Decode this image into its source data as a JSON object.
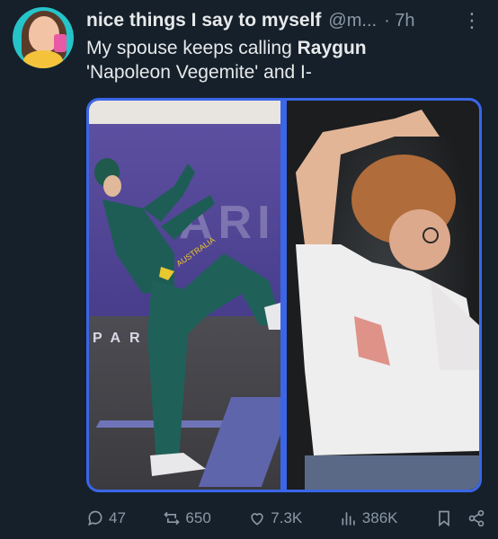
{
  "tweet": {
    "display_name": "nice things I say to myself",
    "handle": "@m...",
    "time": "· 7h",
    "more_icon": "more-icon",
    "text_part1": "My spouse keeps calling ",
    "text_bold": "Raygun",
    "text_part2": "'Napoleon Vegemite' and I-"
  },
  "media": {
    "left_banner_text": "ARI",
    "left_floor_text": "PAR   S",
    "left_jersey_text": "AUSTRALIA"
  },
  "actions": {
    "replies": "47",
    "reposts": "650",
    "likes": "7.3K",
    "views": "386K"
  },
  "colors": {
    "background": "#15202b",
    "accent": "#3b66e8",
    "muted_text": "#8b98a5",
    "primary_text": "#e7e9ea"
  }
}
